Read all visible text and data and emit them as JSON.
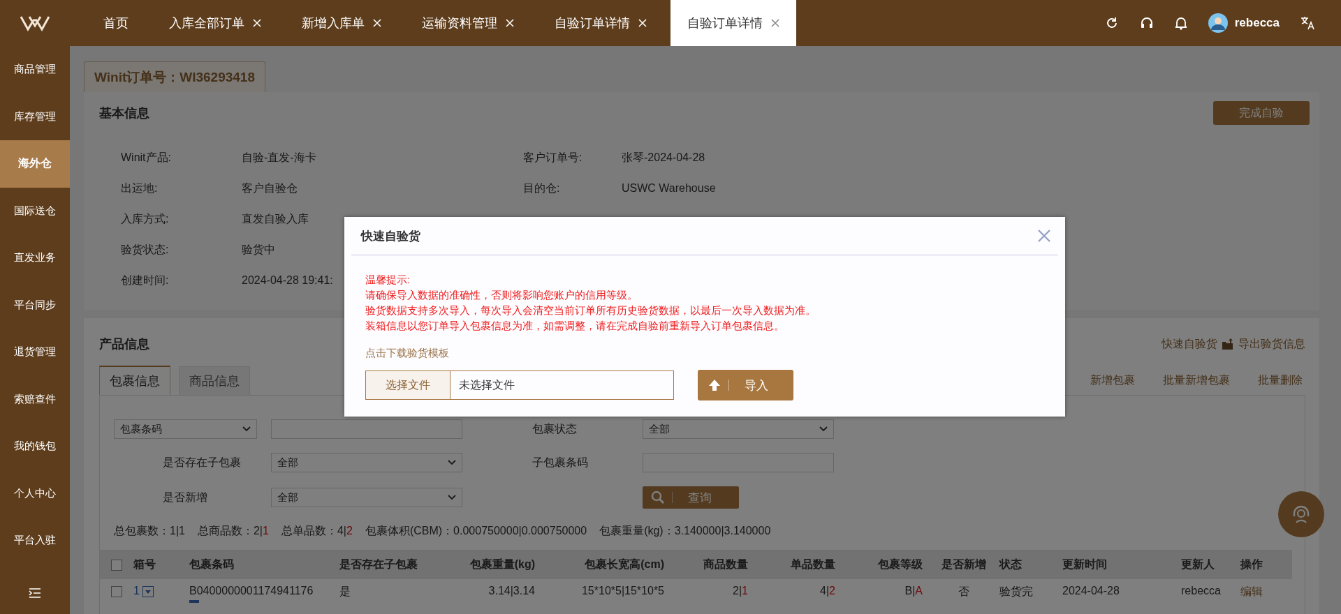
{
  "top_bar": {
    "tabs": [
      {
        "label": "首页",
        "closable": false,
        "selected": false
      },
      {
        "label": "入库全部订单",
        "closable": true,
        "selected": false
      },
      {
        "label": "新增入库单",
        "closable": true,
        "selected": false
      },
      {
        "label": "运输资料管理",
        "closable": true,
        "selected": false
      },
      {
        "label": "自验订单详情",
        "closable": true,
        "selected": false
      },
      {
        "label": "自验订单详情",
        "closable": true,
        "selected": true
      }
    ],
    "user": "rebecca"
  },
  "sidebar": {
    "items": [
      {
        "label": "商品管理",
        "selected": false
      },
      {
        "label": "库存管理",
        "selected": false
      },
      {
        "label": "海外仓",
        "selected": true
      },
      {
        "label": "国际送仓",
        "selected": false
      },
      {
        "label": "直发业务",
        "selected": false
      },
      {
        "label": "平台同步",
        "selected": false
      },
      {
        "label": "退货管理",
        "selected": false
      },
      {
        "label": "索赔查件",
        "selected": false
      },
      {
        "label": "我的钱包",
        "selected": false
      },
      {
        "label": "个人中心",
        "selected": false
      },
      {
        "label": "平台入驻",
        "selected": false
      }
    ]
  },
  "order_tab": "Winit订单号：WI36293418",
  "basic_info": {
    "title": "基本信息",
    "action": "完成自验",
    "left_fields": [
      {
        "label": "Winit产品:",
        "value": "自验-直发-海卡"
      },
      {
        "label": "出运地:",
        "value": "客户自验仓"
      },
      {
        "label": "入库方式:",
        "value": "直发自验入库"
      },
      {
        "label": "验货状态:",
        "value": "验货中"
      },
      {
        "label": "创建时间:",
        "value": "2024-04-28 19:41:"
      }
    ],
    "right_fields": [
      {
        "label": "客户订单号:",
        "value": "张琴-2024-04-28"
      },
      {
        "label": "目的仓:",
        "value": "USWC Warehouse"
      }
    ]
  },
  "product_info": {
    "title": "产品信息",
    "links": [
      {
        "label": "快速自验货",
        "icon": true
      },
      {
        "label": "导出验货信息",
        "icon": false
      }
    ],
    "tabs": [
      {
        "label": "包裹信息",
        "selected": true
      },
      {
        "label": "商品信息",
        "selected": false
      }
    ],
    "actions": [
      "新增包裹",
      "批量新增包裹",
      "批量删除"
    ],
    "filters": {
      "field_select": "包裹条码",
      "status_label": "包裹状态",
      "status_value": "全部",
      "child_label": "是否存在子包裹",
      "child_value": "全部",
      "child_code_label": "子包裹条码",
      "new_label": "是否新增",
      "new_value": "全部",
      "search_button": "查询"
    },
    "summary": [
      {
        "label": "总包裹数：",
        "value": "1|1"
      },
      {
        "label": "总商品数：",
        "value": "2|",
        "diff": "1"
      },
      {
        "label": "总单品数：",
        "value": "4|",
        "diff": "2"
      },
      {
        "label": "包裹体积(CBM)：",
        "value": "0.000750000|0.000750000"
      },
      {
        "label": "包裹重量(kg)：",
        "value": "3.140000|3.140000"
      }
    ],
    "table": {
      "all_checked": false,
      "columns": [
        "箱号",
        "包裹条码",
        "是否存在子包裹",
        "包裹重量(kg)",
        "包裹长宽高(cm)",
        "商品数量",
        "单品数量",
        "包裹等级",
        "是否新增",
        "状态",
        "更新时间",
        "更新人",
        "操作"
      ],
      "rows": [
        {
          "checked": false,
          "box_no": "1",
          "barcode": "B0400000001174941176",
          "has_child": "是",
          "weight": "3.14|3.14",
          "size": "15*10*5|15*10*5",
          "goods_qty": {
            "value": "2|",
            "diff": "1"
          },
          "unit_qty": {
            "value": "4|",
            "diff": "2"
          },
          "grade": {
            "value": "B|",
            "diff": "A"
          },
          "is_new": "否",
          "status": "验货完",
          "updated_at": "2024-04-28",
          "updated_by": "rebecca",
          "action": "编辑"
        }
      ]
    }
  },
  "modal": {
    "title": "快速自验货",
    "notice": [
      "温馨提示:",
      "请确保导入数据的准确性，否则将影响您账户的信用等级。",
      "验货数据支持多次导入，每次导入会清空当前订单所有历史验货数据，以最后一次导入数据为准。",
      "装箱信息以您订单导入包裹信息为准，如需调整，请在完成自验前重新导入订单包裹信息。"
    ],
    "template_link": "点击下载验货模板",
    "file_button": "选择文件",
    "file_status": "未选择文件",
    "import_button": "导入"
  }
}
